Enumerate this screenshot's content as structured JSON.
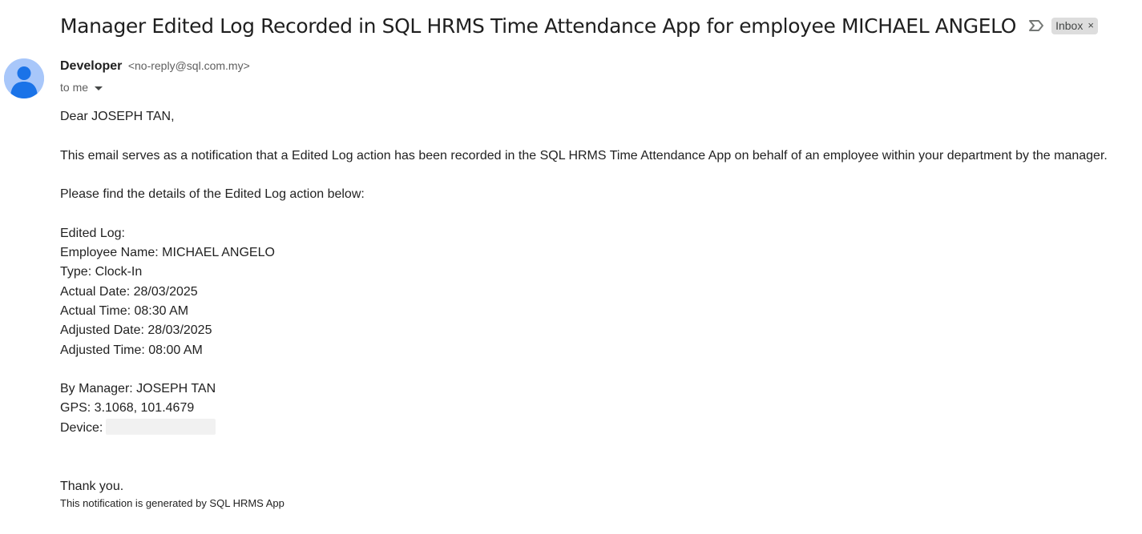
{
  "email": {
    "subject": "Manager Edited Log Recorded in SQL HRMS Time Attendance App for employee MICHAEL ANGELO",
    "label": "Inbox",
    "label_remove": "×",
    "sender": {
      "name": "Developer",
      "email": "<no-reply@sql.com.my>"
    },
    "recipient": "to me",
    "body": {
      "greeting": "Dear JOSEPH TAN,",
      "intro": "This email serves as a notification that a Edited Log action has been recorded in the SQL HRMS Time Attendance App on behalf of an employee within your department by the manager.",
      "details_intro": "Please find the details of the Edited Log action below:",
      "details": [
        "Edited Log:",
        "Employee Name: MICHAEL ANGELO",
        "Type: Clock-In",
        "Actual Date: 28/03/2025",
        "Actual Time: 08:30 AM",
        "Adjusted Date: 28/03/2025",
        "Adjusted Time: 08:00 AM"
      ],
      "manager_line": "By Manager: JOSEPH TAN",
      "gps_line": "GPS: 3.1068, 101.4679",
      "device_label": "Device:",
      "closing": "Thank you.",
      "footer": "This notification is generated by SQL HRMS App"
    }
  },
  "icons": {
    "importance": "importance-marker-icon",
    "avatar": "default-person-avatar-icon",
    "recipient_details": "caret-down-icon"
  },
  "colors": {
    "avatar_bg": "#a8c7fa",
    "avatar_fg": "#1a73e8",
    "label_bg": "#dddddd"
  }
}
